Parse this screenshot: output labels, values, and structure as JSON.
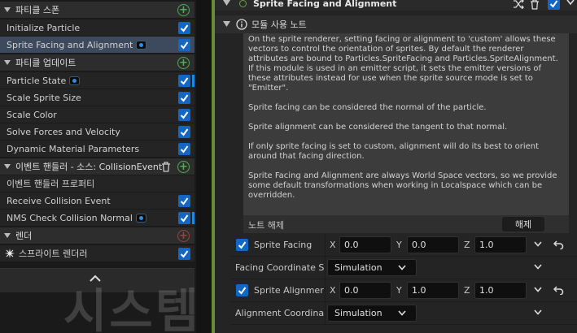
{
  "left": {
    "categories": {
      "spawn": "파티클 스폰",
      "update": "파티클 업데이트",
      "event_handler": "이벤트 핸들러 - 소스: CollisionEvent",
      "render": "렌더"
    },
    "items": {
      "initialize_particle": "Initialize Particle",
      "sprite_facing_alignment": "Sprite Facing and Alignment",
      "particle_state": "Particle State",
      "scale_sprite_size": "Scale Sprite Size",
      "scale_color": "Scale Color",
      "solve_forces": "Solve Forces and Velocity",
      "dynamic_material": "Dynamic Material Parameters",
      "event_handler_props": "이벤트 핸들러 프로퍼티",
      "receive_collision": "Receive Collision Event",
      "nms_check_collision": "NMS Check Collision Normal",
      "sprite_renderer": "스프라이트 렌더러"
    },
    "watermark": "시스템"
  },
  "right": {
    "title": "Sprite Facing and Alignment",
    "note_header": "모듈 사용 노트",
    "note_paragraphs": [
      "On the sprite renderer, setting facing or alignment to 'custom' allows these vectors to control the orientation of sprites. By default the renderer attributes are bound to Particles.SpriteFacing and Particles.SpriteAlignment. If this module is used in an emitter script, it sets the emitter versions of these attributes instead for use when the sprite source mode is set to \"Emitter\".",
      "Sprite facing can be considered the normal of the particle.",
      "Sprite alignment can be considered the tangent to that normal.",
      "If only sprite facing is set to custom, alignment will do its best to orient around that facing direction.",
      "Sprite Facing and Alignment are always World Space vectors, so we provide some default transformations when working in Localspace which can be overridden."
    ],
    "note_footer_label": "노트 해제",
    "dismiss_button": "해제",
    "sprite_facing": {
      "label": "Sprite Facing",
      "x_label": "X",
      "y_label": "Y",
      "z_label": "Z",
      "x": "0.0",
      "y": "0.0",
      "z": "1.0"
    },
    "facing_coordinate_space": {
      "label": "Facing Coordinate S",
      "value": "Simulation"
    },
    "sprite_alignment": {
      "label": "Sprite Alignmer",
      "x_label": "X",
      "y_label": "Y",
      "z_label": "Z",
      "x": "0.0",
      "y": "1.0",
      "z": "1.0"
    },
    "alignment_coordinate_space": {
      "label": "Alignment Coordinat",
      "value": "Simulation"
    }
  }
}
